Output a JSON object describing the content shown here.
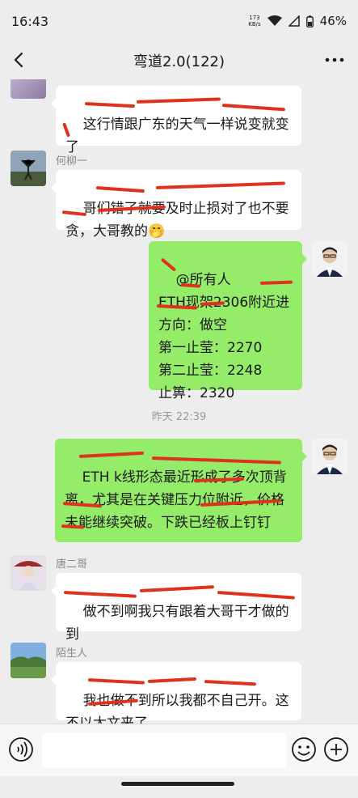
{
  "status": {
    "time": "16:43",
    "net_speed_value": "173",
    "net_speed_unit": "KB/s",
    "battery": "46%"
  },
  "nav": {
    "title": "弯道2.0(122)"
  },
  "messages": [
    {
      "sender": "",
      "text": "这行情跟广东的天气一样说变就变",
      "wrap": "这行情跟广东的天气一样说变就变\n了",
      "mine": false
    },
    {
      "sender": "何柳一",
      "text": "哥们错了就要及时止损对了也不要贪，大哥教的🤭",
      "mine": false
    },
    {
      "sender": "",
      "text": "@所有人\nETH现架2306附近进\n方向：做空\n第一止莹：2270\n第二止莹：2248\n止箅：2320",
      "mine": true
    },
    {
      "sender": "",
      "text": "ETH k线形态最近形成了多次顶背离，尤其是在关键压力位附近，价格未能继续突破。下跌已经板上钉钉",
      "mine": true
    },
    {
      "sender": "唐二哥",
      "text": "做不到啊我只有跟着大哥干才做的到",
      "mine": false
    },
    {
      "sender": "陌生人",
      "text": "我也做不到所以我都不自己开。这不以太文来了",
      "mine": false
    }
  ],
  "timestamp": "昨天 22:39",
  "colors": {
    "mine_bubble": "#95ec69",
    "other_bubble": "#ffffff",
    "background": "#ededed",
    "scribble": "#e0311d"
  },
  "icons": {
    "back": "chevron-left-icon",
    "more": "more-dots-icon",
    "voice": "voice-icon",
    "emoji": "emoji-icon",
    "plus": "plus-icon"
  }
}
